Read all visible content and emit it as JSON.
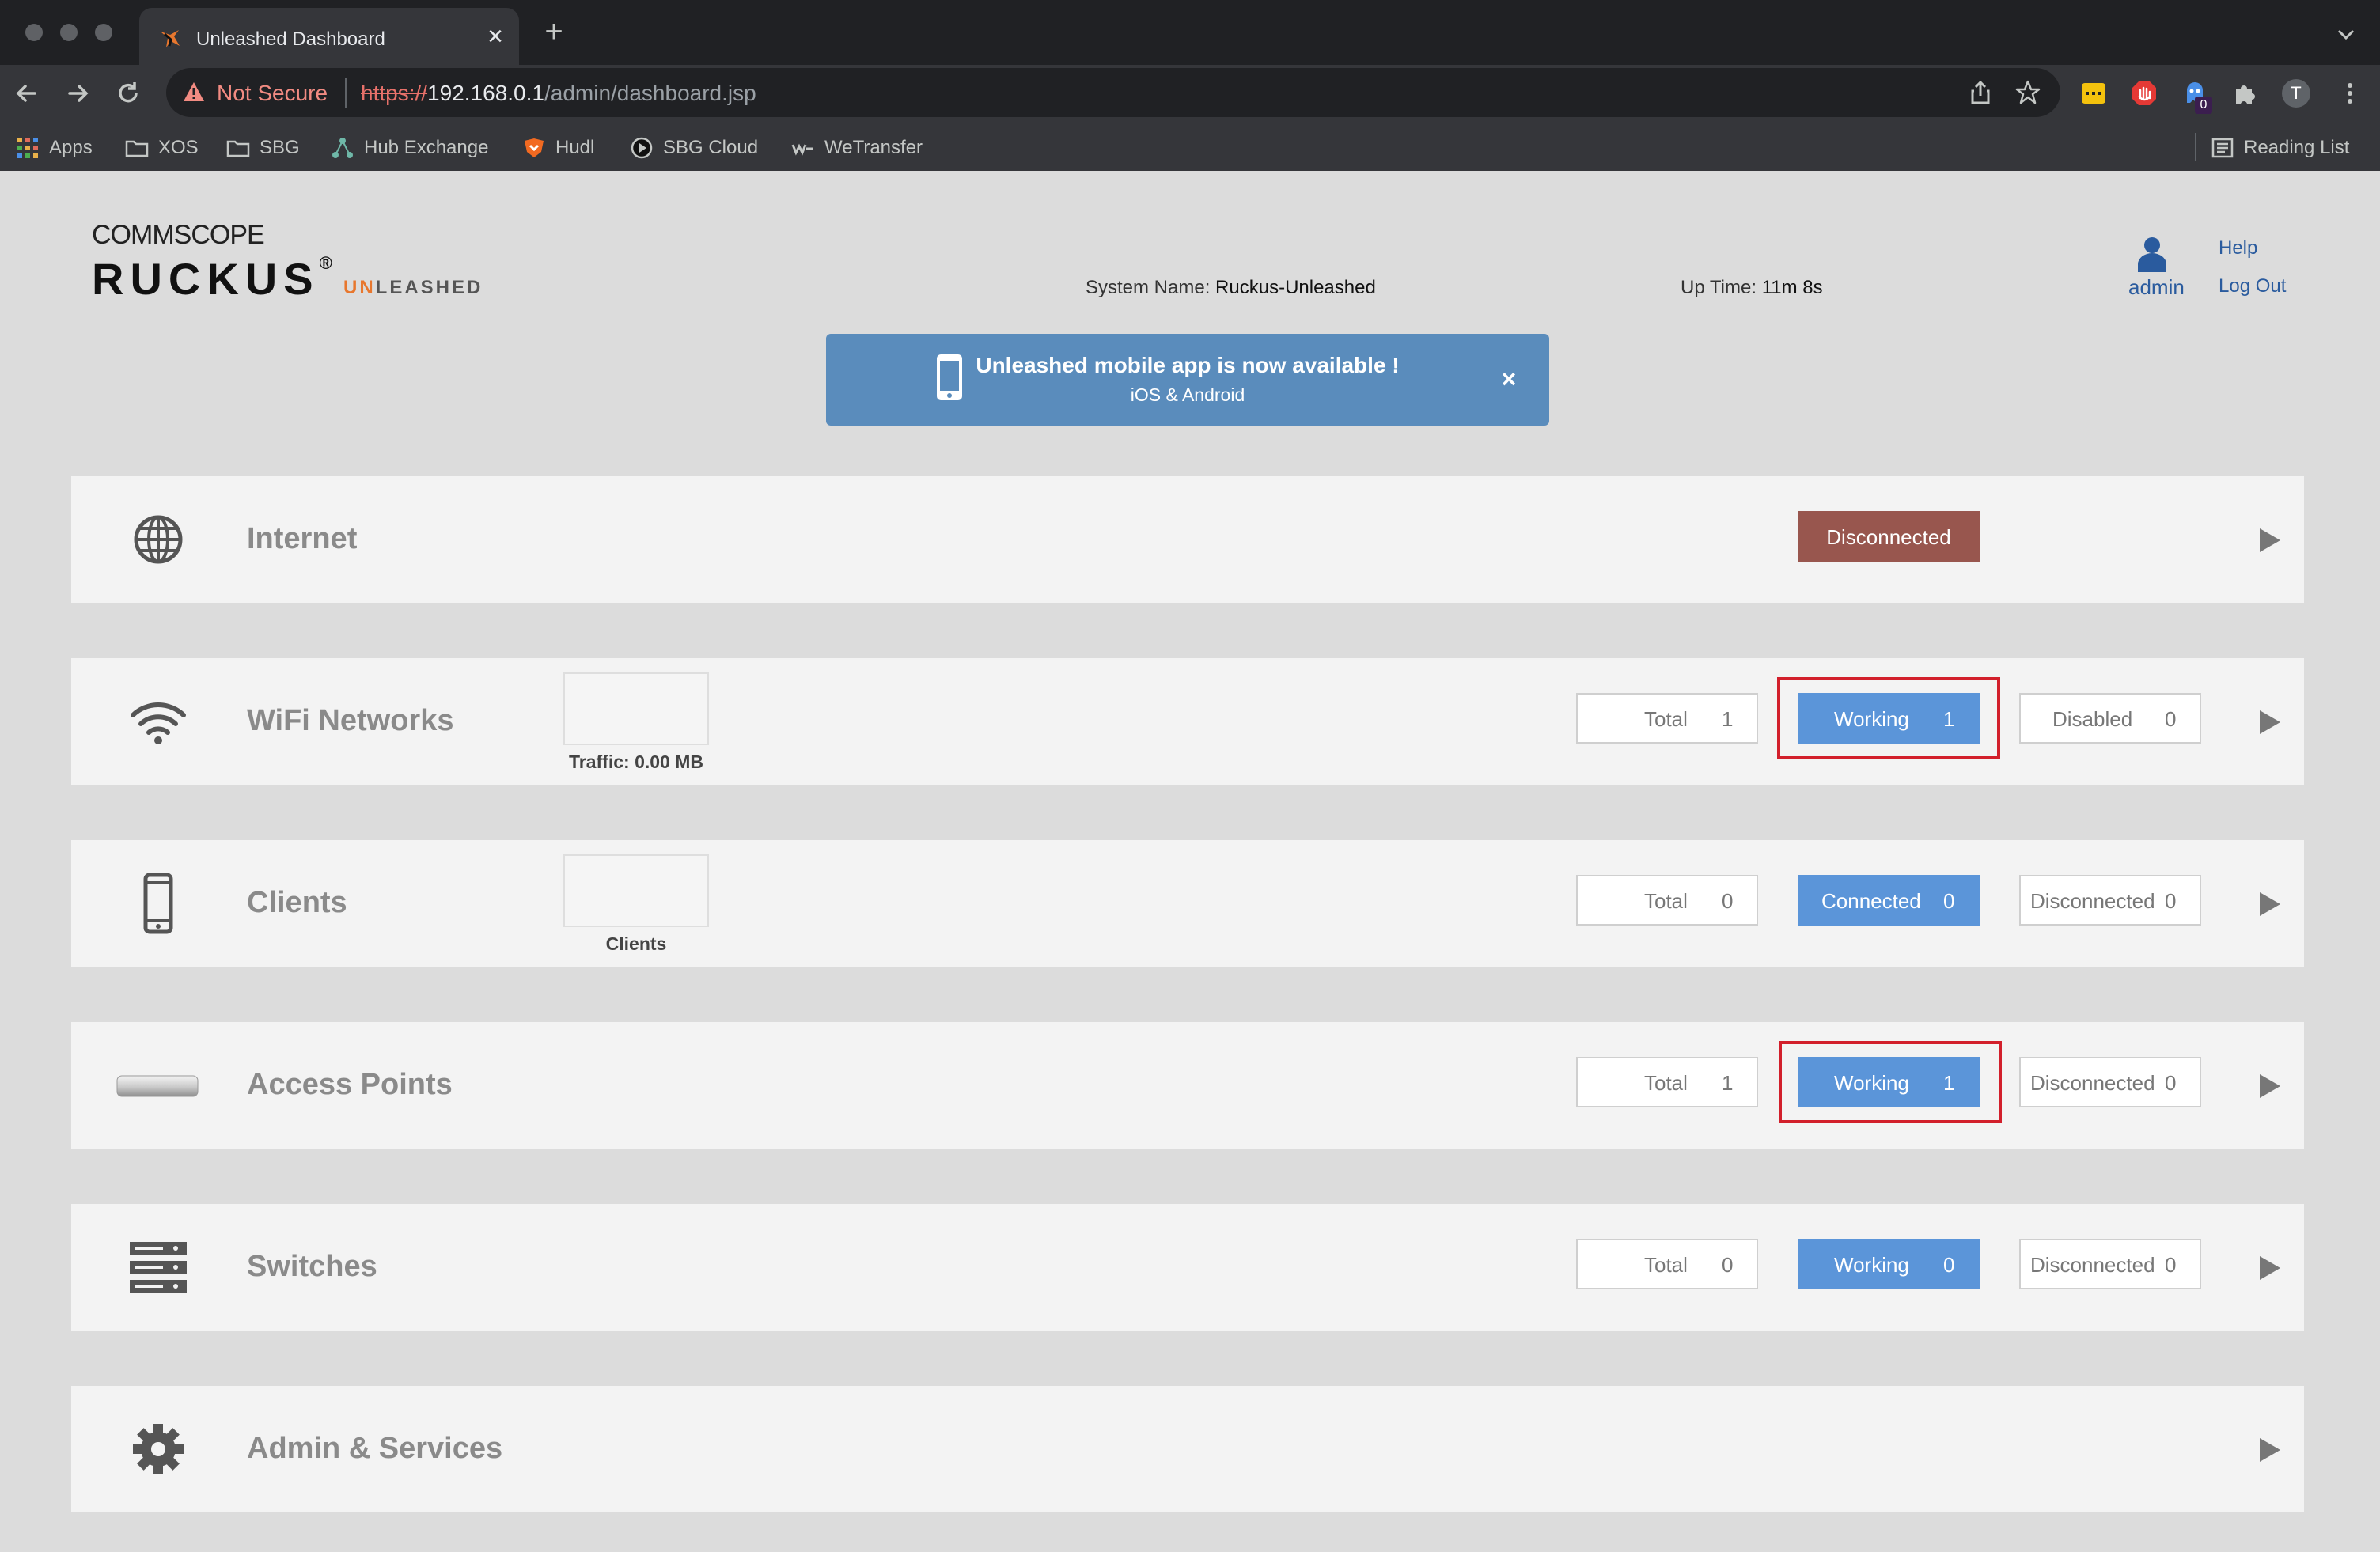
{
  "browser": {
    "tab_title": "Unleashed Dashboard",
    "security_label": "Not Secure",
    "url_scheme": "https://",
    "url_host": "192.168.0.1",
    "url_path": "/admin/dashboard.jsp",
    "profile_initial": "T",
    "extension_badge": "0",
    "bookmarks": [
      "Apps",
      "XOS",
      "SBG",
      "Hub Exchange",
      "Hudl",
      "SBG Cloud",
      "WeTransfer"
    ],
    "reading_list": "Reading List"
  },
  "header": {
    "brand_top": "COMMSCOPE",
    "brand_main": "RUCKUS",
    "brand_reg": "®",
    "product_un": "UN",
    "product_rest": "LEASHED",
    "system_name_label": "System Name:",
    "system_name": "Ruckus-Unleashed",
    "uptime_label": "Up Time:",
    "uptime": "11m 8s",
    "user": "admin",
    "help": "Help",
    "logout": "Log Out"
  },
  "banner": {
    "title": "Unleashed mobile app is now available !",
    "subtitle": "iOS & Android",
    "close": "×"
  },
  "rows": {
    "internet": {
      "title": "Internet",
      "status": "Disconnected"
    },
    "wifi": {
      "title": "WiFi Networks",
      "caption": "Traffic: 0.00 MB",
      "total_label": "Total",
      "total": "1",
      "working_label": "Working",
      "working": "1",
      "disabled_label": "Disabled",
      "disabled": "0"
    },
    "clients": {
      "title": "Clients",
      "caption": "Clients",
      "total_label": "Total",
      "total": "0",
      "connected_label": "Connected",
      "connected": "0",
      "disconnected_label": "Disconnected",
      "disconnected": "0"
    },
    "aps": {
      "title": "Access Points",
      "total_label": "Total",
      "total": "1",
      "working_label": "Working",
      "working": "1",
      "disconnected_label": "Disconnected",
      "disconnected": "0"
    },
    "switches": {
      "title": "Switches",
      "total_label": "Total",
      "total": "0",
      "working_label": "Working",
      "working": "0",
      "disconnected_label": "Disconnected",
      "disconnected": "0"
    },
    "admin": {
      "title": "Admin & Services"
    }
  },
  "colors": {
    "working_blue": "#5b95d9",
    "disconnected_maroon": "#98564e",
    "highlight_red": "#d21f2b",
    "banner_blue": "#5a8cbc",
    "brand_orange": "#e8772e"
  }
}
